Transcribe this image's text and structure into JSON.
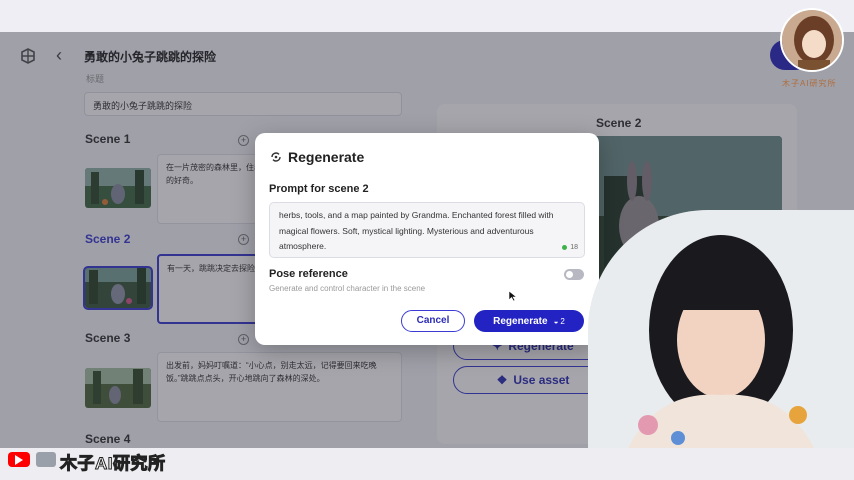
{
  "app": {
    "title": "勇敢的小兔子跳跳的探险",
    "small_label": "标题",
    "title_input_value": "勇敢的小兔子跳跳的探险"
  },
  "scenes": [
    {
      "label": "Scene 1",
      "text": "在一片茂密的森林里，住着……跳跳有一对长长的耳朵……世界的好奇。"
    },
    {
      "label": "Scene 2",
      "text": "有一天，跳跳决定去探险……背包，里面装满了胡萝卜"
    },
    {
      "label": "Scene 3",
      "text": "出发前，妈妈叮嘱道：“小心点，别走太远，记得要回来吃晚饭。”跳跳点点头，开心地跳向了森林的深处。"
    },
    {
      "label": "Scene 4",
      "text": ""
    }
  ],
  "right_panel": {
    "title": "Scene 2",
    "regenerate_label": "Regenerate",
    "use_asset_label": "Use asset"
  },
  "modal": {
    "title": "Regenerate",
    "prompt_label": "Prompt for scene 2",
    "prompt_text": "herbs, tools, and a map painted by Grandma. Enchanted forest filled with magical flowers. Soft, mystical lighting. Mysterious and adventurous atmosphere.",
    "prompt_count": "18",
    "pose_label": "Pose reference",
    "pose_desc": "Generate and control character in the scene",
    "pose_enabled": false,
    "cancel_label": "Cancel",
    "regenerate_label": "Regenerate",
    "credit_cost": "2"
  },
  "watermark": {
    "name": "木子AI研究所"
  },
  "bottom_bar": {
    "channel_name": "木子AI研究所"
  },
  "colors": {
    "accent": "#2323c4",
    "accent_text": "#2d2db5",
    "overlay": "rgba(40,40,55,0.42)",
    "youtube_red": "#ff0000"
  }
}
